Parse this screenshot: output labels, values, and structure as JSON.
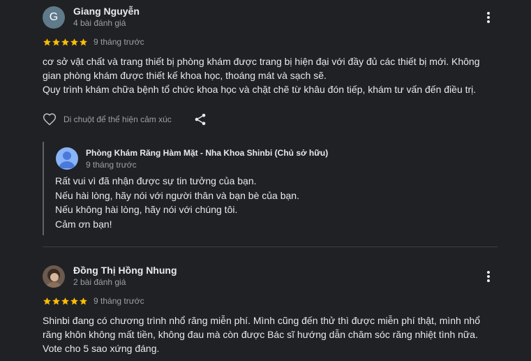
{
  "reviews": [
    {
      "avatar_letter": "G",
      "name": "Giang Nguyễn",
      "meta": "4 bài đánh giá",
      "rating": 5,
      "time": "9 tháng trước",
      "text_lines": [
        "cơ sở vật chất và trang thiết bị phòng khám được trang bị hiện đại với đầy đủ các thiết bị mới. Không",
        "gian phòng khám được thiết kế khoa học, thoáng mát và sạch sẽ.",
        "Quy trình khám chữa bệnh tổ chức khoa học và chặt chẽ từ khâu đón tiếp, khám tư vấn đến điều trị."
      ],
      "hover_hint": "Di chuột để thể hiện cảm xúc",
      "owner_reply": {
        "name": "Phòng Khám Răng Hàm Mặt - Nha Khoa Shinbi (Chủ sở hữu)",
        "time": "9 tháng trước",
        "lines": [
          "Rất vui vì đã nhận được sự tin tưởng của bạn.",
          "Nếu hài lòng, hãy nói với người thân và bạn bè của bạn.",
          "Nếu không hài lòng, hãy nói với chúng tôi.",
          "Cảm ơn bạn!"
        ]
      }
    },
    {
      "name": "Đồng Thị Hồng Nhung",
      "meta": "2 bài đánh giá",
      "rating": 5,
      "time": "9 tháng trước",
      "text_lines": [
        "Shinbi đang có chương trình nhổ răng miễn phí. Mình cũng đến thử thì được miễn phí thật, mình nhổ",
        "răng khôn không mất tiền, không đau mà còn được Bác sĩ hướng dẫn chăm sóc răng nhiệt tình nữa.",
        "Vote cho 5 sao xứng đáng."
      ]
    }
  ],
  "icons": {
    "more": "more-vert-icon",
    "star": "star-icon",
    "heart": "heart-outline-icon",
    "share": "share-icon",
    "owner_avatar": "person-icon"
  },
  "colors": {
    "background": "#202124",
    "star": "#fbbc04",
    "text": "#e8eaed",
    "muted": "#9aa0a6",
    "owner_avatar": "#8ab4f8"
  }
}
